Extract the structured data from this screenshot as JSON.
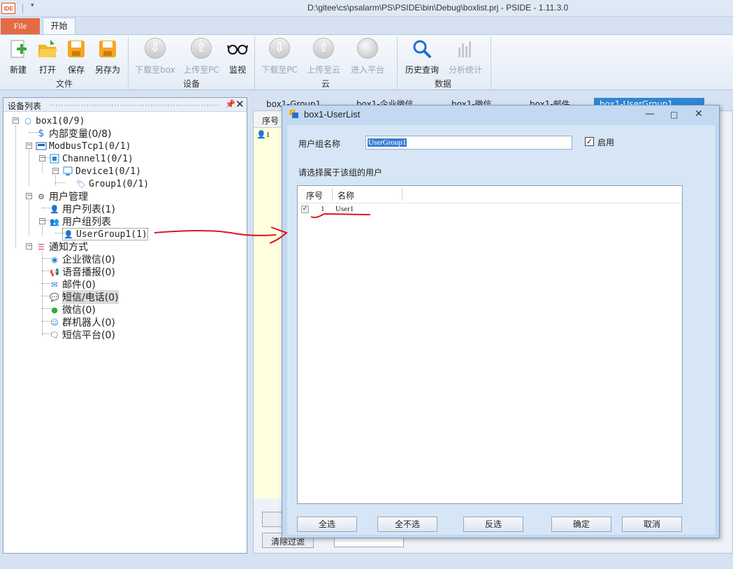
{
  "window": {
    "title": "D:\\gitee\\cs\\psalarm\\PS\\PSIDE\\bin\\Debug\\boxlist.prj - PSIDE - 1.11.3.0",
    "logo": "IDE"
  },
  "ribbon": {
    "tabs": [
      {
        "label": "File"
      },
      {
        "label": "开始"
      }
    ],
    "groups": [
      {
        "label": "文件",
        "buttons": [
          {
            "label": "新建",
            "icon": "new-icon"
          },
          {
            "label": "打开",
            "icon": "open-folder-icon"
          },
          {
            "label": "保存",
            "icon": "save-icon"
          },
          {
            "label": "另存为",
            "icon": "save-as-icon"
          }
        ]
      },
      {
        "label": "设备",
        "buttons": [
          {
            "label": "下载至box",
            "icon": "download-icon"
          },
          {
            "label": "上传至PC",
            "icon": "upload-icon"
          },
          {
            "label": "监视",
            "icon": "glasses-icon"
          }
        ]
      },
      {
        "label": "云",
        "buttons": [
          {
            "label": "下载至PC",
            "icon": "download-icon"
          },
          {
            "label": "上传至云",
            "icon": "upload-icon"
          },
          {
            "label": "进入平台",
            "icon": "globe-icon"
          }
        ]
      },
      {
        "label": "数据",
        "buttons": [
          {
            "label": "历史查询",
            "icon": "search-icon"
          },
          {
            "label": "分析统计",
            "icon": "chart-icon"
          }
        ]
      }
    ]
  },
  "device_panel": {
    "title": "设备列表",
    "tree": [
      {
        "label": "box1(0/9)"
      },
      {
        "label": "内部变量(0/8)"
      },
      {
        "label": "ModbusTcp1(0/1)"
      },
      {
        "label": "Channel1(0/1)"
      },
      {
        "label": "Device1(0/1)"
      },
      {
        "label": "Group1(0/1)"
      },
      {
        "label": "用户管理"
      },
      {
        "label": "用户列表(1)"
      },
      {
        "label": "用户组列表"
      },
      {
        "label": "UserGroup1(1)"
      },
      {
        "label": "通知方式"
      },
      {
        "label": "企业微信(0)"
      },
      {
        "label": "语音播报(0)"
      },
      {
        "label": "邮件(0)"
      },
      {
        "label": "短信/电话(0)"
      },
      {
        "label": "微信(0)"
      },
      {
        "label": "群机器人(0)"
      },
      {
        "label": "短信平台(0)"
      }
    ]
  },
  "doc_tabs": [
    "box1-Group1",
    "box1-企业微信",
    "box1-微信",
    "box1-邮件",
    "box1-UserGroup1"
  ],
  "doc_grid": {
    "header": "序号",
    "row1": "1",
    "btn_clear": "清除过滤"
  },
  "dialog": {
    "title": "box1-UserList",
    "group_name_label": "用户组名称",
    "group_name_value": "UserGroup1",
    "enable_label": "启用",
    "enable_checked": true,
    "select_label": "请选择属于该组的用户",
    "columns": [
      "序号",
      "名称"
    ],
    "rows": [
      {
        "no": "1",
        "name": "User1",
        "checked": true
      }
    ],
    "buttons": {
      "select_all": "全选",
      "select_none": "全不选",
      "invert": "反选",
      "ok": "确定",
      "cancel": "取消"
    }
  },
  "colors": {
    "accent": "#2e86d6",
    "file_tab": "#e36c44",
    "annotation": "#e0141e"
  }
}
